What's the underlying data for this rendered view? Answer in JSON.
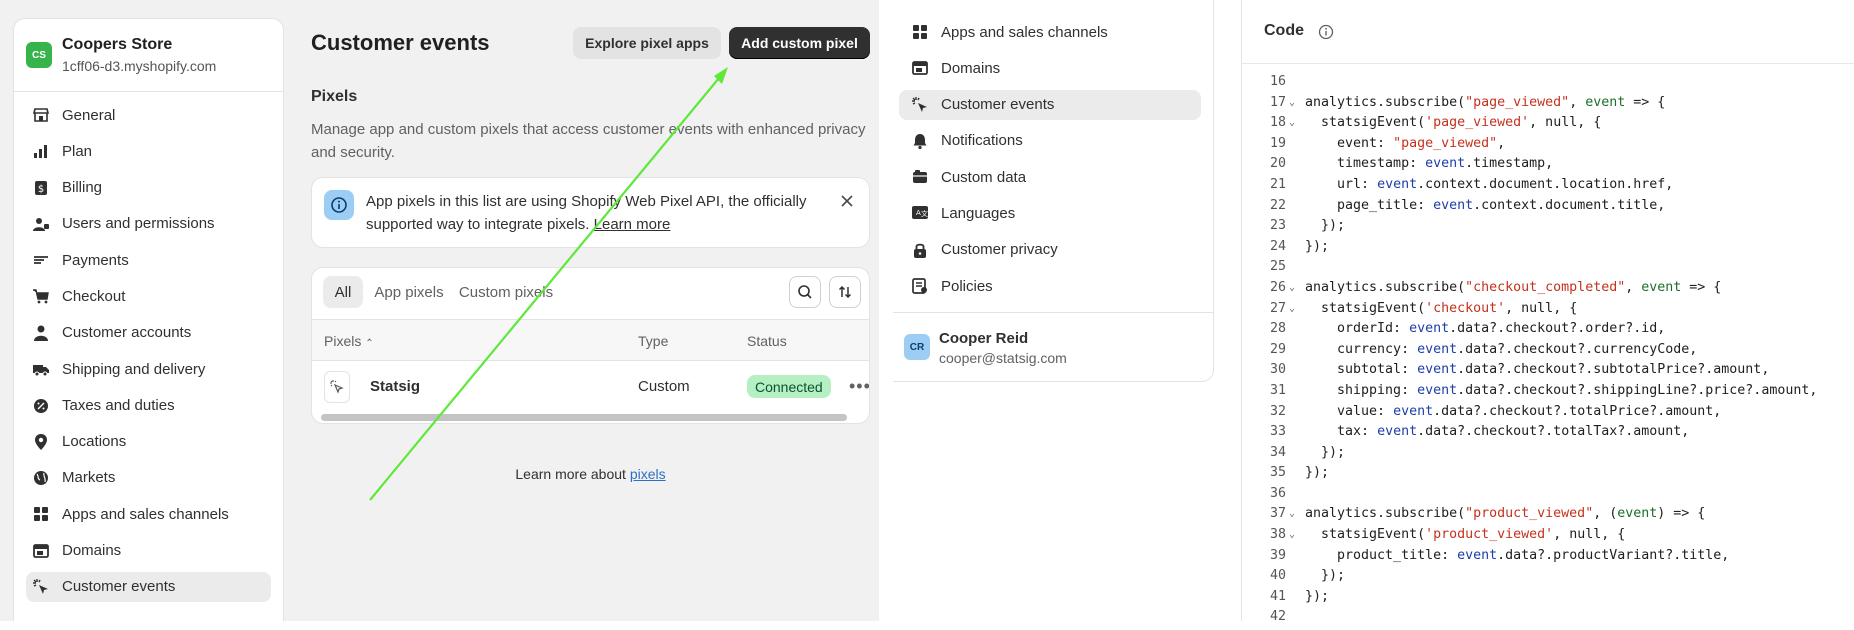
{
  "sidebar": {
    "store": {
      "avatar": "CS",
      "name": "Coopers Store",
      "domain": "1cff06-d3.myshopify.com"
    },
    "items": [
      {
        "label": "General",
        "icon": "store-icon"
      },
      {
        "label": "Plan",
        "icon": "plan-icon"
      },
      {
        "label": "Billing",
        "icon": "billing-icon"
      },
      {
        "label": "Users and permissions",
        "icon": "users-icon"
      },
      {
        "label": "Payments",
        "icon": "payments-icon"
      },
      {
        "label": "Checkout",
        "icon": "cart-icon"
      },
      {
        "label": "Customer accounts",
        "icon": "person-icon"
      },
      {
        "label": "Shipping and delivery",
        "icon": "truck-icon"
      },
      {
        "label": "Taxes and duties",
        "icon": "tax-icon"
      },
      {
        "label": "Locations",
        "icon": "location-icon"
      },
      {
        "label": "Markets",
        "icon": "globe-icon"
      },
      {
        "label": "Apps and sales channels",
        "icon": "apps-icon"
      },
      {
        "label": "Domains",
        "icon": "domains-icon"
      },
      {
        "label": "Customer events",
        "icon": "cursor-icon",
        "active": true
      }
    ]
  },
  "main": {
    "title": "Customer events",
    "explore_button": "Explore pixel apps",
    "add_button": "Add custom pixel",
    "section_title": "Pixels",
    "section_desc": "Manage app and custom pixels that access customer events with enhanced privacy and security.",
    "banner": {
      "text": "App pixels in this list are using Shopify Web Pixel API, the officially supported way to integrate pixels.",
      "link": "Learn more"
    },
    "tabs": [
      "All",
      "App pixels",
      "Custom pixels"
    ],
    "columns": {
      "name": "Pixels",
      "type": "Type",
      "status": "Status"
    },
    "rows": [
      {
        "name": "Statsig",
        "type": "Custom",
        "status": "Connected"
      }
    ],
    "footer_text": "Learn more about",
    "footer_link": "pixels"
  },
  "panel2": {
    "items": [
      {
        "label": "Apps and sales channels",
        "icon": "apps-icon"
      },
      {
        "label": "Domains",
        "icon": "domains-icon"
      },
      {
        "label": "Customer events",
        "icon": "cursor-icon",
        "active": true
      },
      {
        "label": "Notifications",
        "icon": "bell-icon"
      },
      {
        "label": "Custom data",
        "icon": "folder-icon"
      },
      {
        "label": "Languages",
        "icon": "translate-icon"
      },
      {
        "label": "Customer privacy",
        "icon": "lock-icon"
      },
      {
        "label": "Policies",
        "icon": "policy-icon"
      }
    ],
    "user": {
      "avatar": "CR",
      "name": "Cooper Reid",
      "email": "cooper@statsig.com"
    }
  },
  "code": {
    "title": "Code",
    "lines": [
      {
        "n": "16",
        "fold": false,
        "html": ""
      },
      {
        "n": "17",
        "fold": true,
        "html": "analytics.subscribe(<span class='s'>\"page_viewed\"</span>, <span class='p'>event</span> => {"
      },
      {
        "n": "18",
        "fold": true,
        "html": "  statsigEvent(<span class='s'>'page_viewed'</span>, null, {"
      },
      {
        "n": "19",
        "fold": false,
        "html": "    event: <span class='s'>\"page_viewed\"</span>,"
      },
      {
        "n": "20",
        "fold": false,
        "html": "    timestamp: <span class='pr'>event</span>.timestamp,"
      },
      {
        "n": "21",
        "fold": false,
        "html": "    url: <span class='pr'>event</span>.context.document.location.href,"
      },
      {
        "n": "22",
        "fold": false,
        "html": "    page_title: <span class='pr'>event</span>.context.document.title,"
      },
      {
        "n": "23",
        "fold": false,
        "html": "  });"
      },
      {
        "n": "24",
        "fold": false,
        "html": "});"
      },
      {
        "n": "25",
        "fold": false,
        "html": ""
      },
      {
        "n": "26",
        "fold": true,
        "html": "analytics.subscribe(<span class='s'>\"checkout_completed\"</span>, <span class='p'>event</span> => {"
      },
      {
        "n": "27",
        "fold": true,
        "html": "  statsigEvent(<span class='s'>'checkout'</span>, null, {"
      },
      {
        "n": "28",
        "fold": false,
        "html": "    orderId: <span class='pr'>event</span>.data?.checkout?.order?.id,"
      },
      {
        "n": "29",
        "fold": false,
        "html": "    currency: <span class='pr'>event</span>.data?.checkout?.currencyCode,"
      },
      {
        "n": "30",
        "fold": false,
        "html": "    subtotal: <span class='pr'>event</span>.data?.checkout?.subtotalPrice?.amount,"
      },
      {
        "n": "31",
        "fold": false,
        "html": "    shipping: <span class='pr'>event</span>.data?.checkout?.shippingLine?.price?.amount,"
      },
      {
        "n": "32",
        "fold": false,
        "html": "    value: <span class='pr'>event</span>.data?.checkout?.totalPrice?.amount,"
      },
      {
        "n": "33",
        "fold": false,
        "html": "    tax: <span class='pr'>event</span>.data?.checkout?.totalTax?.amount,"
      },
      {
        "n": "34",
        "fold": false,
        "html": "  });"
      },
      {
        "n": "35",
        "fold": false,
        "html": "});"
      },
      {
        "n": "36",
        "fold": false,
        "html": ""
      },
      {
        "n": "37",
        "fold": true,
        "html": "analytics.subscribe(<span class='s'>\"product_viewed\"</span>, (<span class='p'>event</span>) => {"
      },
      {
        "n": "38",
        "fold": true,
        "html": "  statsigEvent(<span class='s'>'product_viewed'</span>, null, {"
      },
      {
        "n": "39",
        "fold": false,
        "html": "    product_title: <span class='pr'>event</span>.data?.productVariant?.title,"
      },
      {
        "n": "40",
        "fold": false,
        "html": "  });"
      },
      {
        "n": "41",
        "fold": false,
        "html": "});"
      },
      {
        "n": "42",
        "fold": false,
        "html": ""
      }
    ]
  },
  "colors": {
    "accent_green": "#5ee83a",
    "status_bg": "#b4f0c2",
    "store_avatar": "#36b34a",
    "user_avatar": "#9bcdf5"
  }
}
